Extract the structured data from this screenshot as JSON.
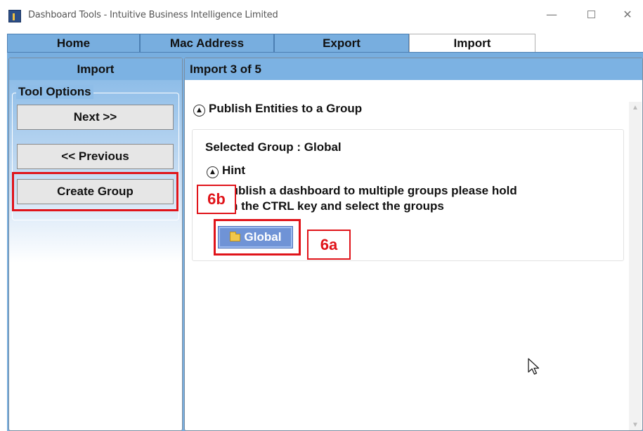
{
  "window": {
    "title": "Dashboard Tools - Intuitive Business Intelligence Limited",
    "minimize": "—",
    "close": "✕"
  },
  "tabs": [
    {
      "label": "Home",
      "active": false
    },
    {
      "label": "Mac Address",
      "active": false
    },
    {
      "label": "Export",
      "active": false
    },
    {
      "label": "Import",
      "active": true
    }
  ],
  "left_panel": {
    "header": "Import",
    "group_label": "Tool Options",
    "buttons": {
      "next": "Next >>",
      "previous": "<< Previous",
      "create_group": "Create Group"
    }
  },
  "right_panel": {
    "header": "Import 3 of 5",
    "section_title": "Publish Entities to a Group",
    "selected_group": "Selected Group : Global",
    "hint_title": "Hint",
    "hint_line1": "To publish a dashboard to multiple groups please hold",
    "hint_line2": "down the CTRL key and select the groups",
    "group_button": "Global"
  },
  "annotations": {
    "callout_a": "6a",
    "callout_b": "6b",
    "highlight_color": "#e0141a"
  },
  "colors": {
    "tab_blue": "#78aedf",
    "header_blue": "#7cb2e3",
    "group_button": "#6f93d6"
  }
}
